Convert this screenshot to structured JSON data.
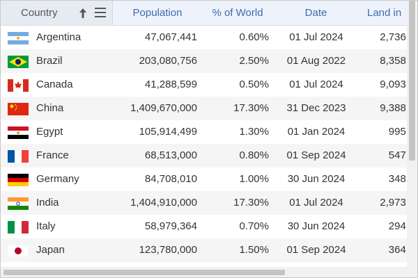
{
  "columns": {
    "country": "Country",
    "population": "Population",
    "percent": "% of World",
    "date": "Date",
    "land": "Land in"
  },
  "rows": [
    {
      "country": "Argentina",
      "population": "47,067,441",
      "percent": "0.60%",
      "date": "01 Jul 2024",
      "land": "2,736,",
      "flag": "argentina-flag"
    },
    {
      "country": "Brazil",
      "population": "203,080,756",
      "percent": "2.50%",
      "date": "01 Aug 2022",
      "land": "8,358,",
      "flag": "brazil-flag"
    },
    {
      "country": "Canada",
      "population": "41,288,599",
      "percent": "0.50%",
      "date": "01 Jul 2024",
      "land": "9,093,",
      "flag": "canada-flag"
    },
    {
      "country": "China",
      "population": "1,409,670,000",
      "percent": "17.30%",
      "date": "31 Dec 2023",
      "land": "9,388,",
      "flag": "china-flag"
    },
    {
      "country": "Egypt",
      "population": "105,914,499",
      "percent": "1.30%",
      "date": "01 Jan 2024",
      "land": "995,",
      "flag": "egypt-flag"
    },
    {
      "country": "France",
      "population": "68,513,000",
      "percent": "0.80%",
      "date": "01 Sep 2024",
      "land": "547,",
      "flag": "france-flag"
    },
    {
      "country": "Germany",
      "population": "84,708,010",
      "percent": "1.00%",
      "date": "30 Jun 2024",
      "land": "348,",
      "flag": "germany-flag"
    },
    {
      "country": "India",
      "population": "1,404,910,000",
      "percent": "17.30%",
      "date": "01 Jul 2024",
      "land": "2,973,",
      "flag": "india-flag"
    },
    {
      "country": "Italy",
      "population": "58,979,364",
      "percent": "0.70%",
      "date": "30 Jun 2024",
      "land": "294,",
      "flag": "italy-flag"
    },
    {
      "country": "Japan",
      "population": "123,780,000",
      "percent": "1.50%",
      "date": "01 Sep 2024",
      "land": "364,",
      "flag": "japan-flag"
    }
  ]
}
